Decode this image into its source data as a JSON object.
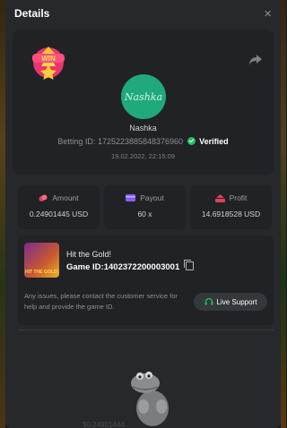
{
  "modal": {
    "title": "Details",
    "close_glyph": "×"
  },
  "bet": {
    "badge_text": "WIN",
    "avatar_text": "Nashka",
    "username": "Nashka",
    "betting_id_label": "Betting ID:",
    "betting_id": "1725223885848376960",
    "verified_label": "Verified",
    "datetime": "19.02.2022, 22:15:09"
  },
  "stats": [
    {
      "label": "Amount",
      "value": "0.24901445 USD",
      "icon": "coins-icon",
      "color": "#e0425a"
    },
    {
      "label": "Payout",
      "value": "60 x",
      "icon": "card-icon",
      "color": "#8a5cf0"
    },
    {
      "label": "Profit",
      "value": "14.6918528 USD",
      "icon": "profit-icon",
      "color": "#e0425a"
    }
  ],
  "game": {
    "name": "Hit the Gold!",
    "thumb_text": "HIT THE GOLD!",
    "id_label": "Game ID:",
    "id_value": "1402372200003001",
    "issues_text": "Any issues, please contact the customer service for help and provide the game ID.",
    "support_label": "Live Support"
  },
  "background_peek": "$0.24901444",
  "colors": {
    "verified": "#1ec35d",
    "avatar": "#1fa97c",
    "accent": "#e0425a"
  }
}
